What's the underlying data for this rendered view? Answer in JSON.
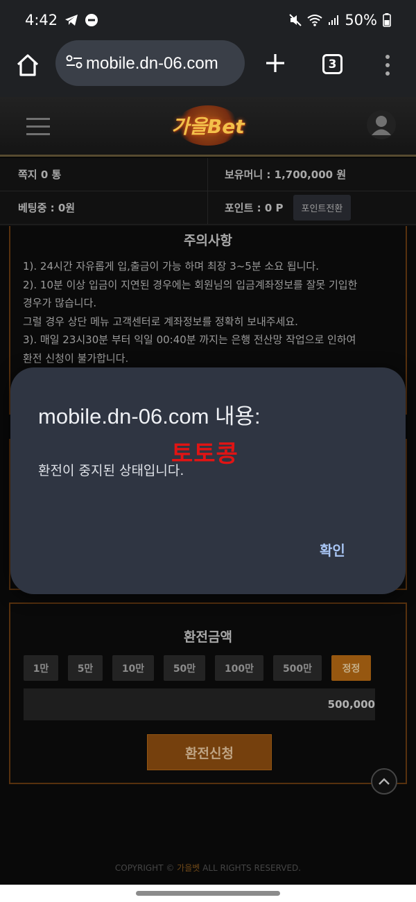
{
  "status_bar": {
    "time": "4:42",
    "battery": "50%",
    "icons": [
      "telegram-icon",
      "do-not-disturb-icon",
      "mute-icon",
      "wifi-icon",
      "signal-icon",
      "battery-icon"
    ]
  },
  "browser": {
    "url": "mobile.dn-06.com",
    "tab_count": "3",
    "icons": [
      "home-icon",
      "site-settings-icon",
      "plus-icon",
      "more-vert-icon"
    ]
  },
  "header": {
    "logo": "가을Bet"
  },
  "info": {
    "messages": "쪽지 0 통",
    "money": "보유머니 : 1,700,000 원",
    "betting": "베팅중 : 0원",
    "points": "포인트 : 0 P",
    "points_button": "포인트전환"
  },
  "notice": {
    "title": "주의사항",
    "lines": [
      "1). 24시간 자유롭게 입,출금이 가능 하며 최장 3~5분 소요 됩니다.",
      "2). 10분 이상 입금이 지연된 경우에는 회원님의 입금계좌정보를 잘못 기입한",
      "경우가 많습니다.",
      "그럴 경우 상단 메뉴 고객센터로 계좌정보를 정확히 보내주세요.",
      "3). 매일 23시30분 부터 익일 00:40분 까지는 은행 전산망 작업으로 인하여",
      "환전 신청이 불가합니다."
    ]
  },
  "exchange": {
    "title": "환전금액",
    "buttons": [
      "1만",
      "5만",
      "10만",
      "50만",
      "100만",
      "500만",
      "정정"
    ],
    "amount": "500,000",
    "submit": "환전신청"
  },
  "footer": {
    "prefix": "COPYRIGHT © ",
    "brand": "가을벳",
    "suffix": " ALL RIGHTS RESERVED."
  },
  "dialog": {
    "title": "mobile.dn-06.com 내용:",
    "watermark": "토토콩",
    "message": "환전이 중지된 상태입니다.",
    "ok": "확인"
  },
  "colors": {
    "accent": "#b86b14",
    "dialog_bg": "#2f3542",
    "watermark": "#e01414",
    "ok_link": "#a9c6f5"
  }
}
